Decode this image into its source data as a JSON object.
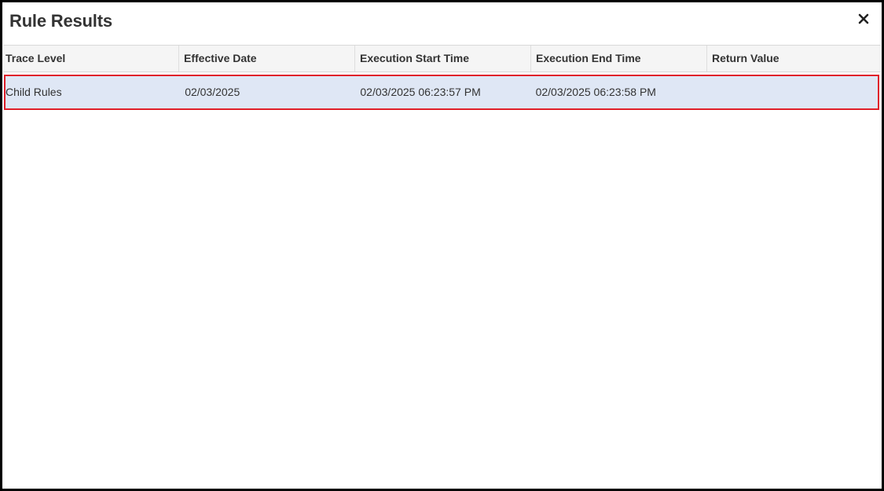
{
  "dialog": {
    "title": "Rule Results",
    "close_icon": "close-icon"
  },
  "table": {
    "columns": [
      "Trace Level",
      "Effective Date",
      "Execution Start Time",
      "Execution End Time",
      "Return Value"
    ],
    "rows": [
      {
        "trace_level": "Child Rules",
        "effective_date": "02/03/2025",
        "execution_start_time": "02/03/2025 06:23:57 PM",
        "execution_end_time": "02/03/2025 06:23:58 PM",
        "return_value": ""
      }
    ],
    "selected_row_highlight": "#dfe7f5",
    "selected_row_outline": "#e0202a"
  }
}
